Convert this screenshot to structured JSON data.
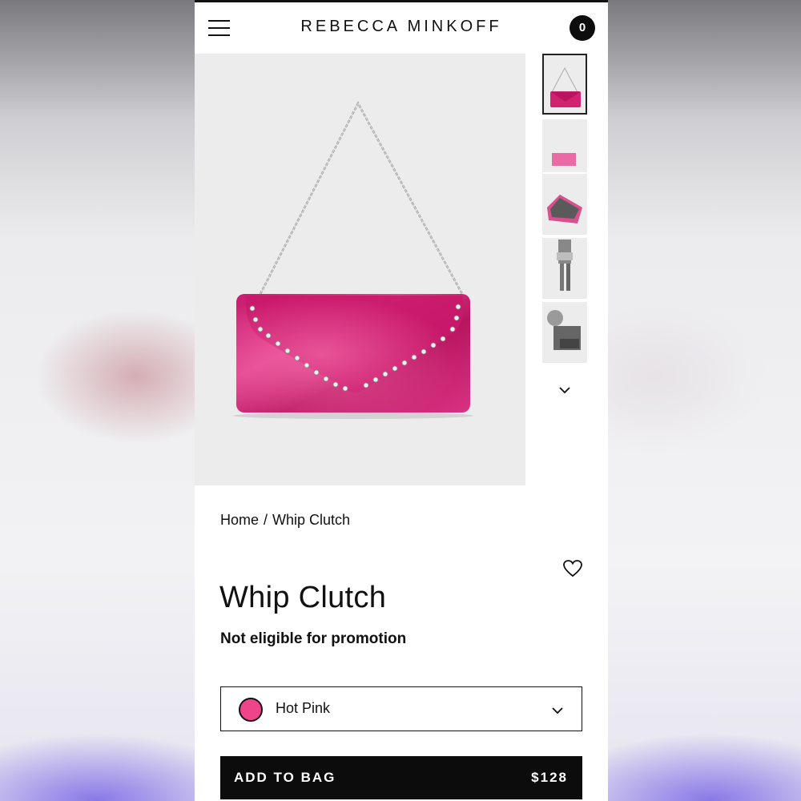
{
  "header": {
    "brand": "REBECCA MINKOFF",
    "bag_count": "0",
    "menu_icon": "hamburger-menu-icon",
    "bag_icon": "bag-count-badge"
  },
  "gallery": {
    "main_image": "pink-velvet-clutch-with-chain",
    "thumbnails": [
      "clutch-front",
      "clutch-small-flat",
      "clutch-open-interior",
      "model-wearing-clutch",
      "model-holding-clutch"
    ],
    "scroll_icon": "chevron-down-icon"
  },
  "breadcrumb": {
    "home": "Home",
    "separator": "/",
    "current": "Whip Clutch"
  },
  "product": {
    "title": "Whip Clutch",
    "promo_note": "Not eligible for promotion",
    "wishlist_icon": "heart-icon"
  },
  "color_selector": {
    "selected": "Hot Pink",
    "swatch_color": "#f0448a"
  },
  "cta": {
    "label": "ADD TO BAG",
    "price": "$128"
  },
  "colors": {
    "accent": "#0c0c0c",
    "product_pink": "#d4277a"
  }
}
